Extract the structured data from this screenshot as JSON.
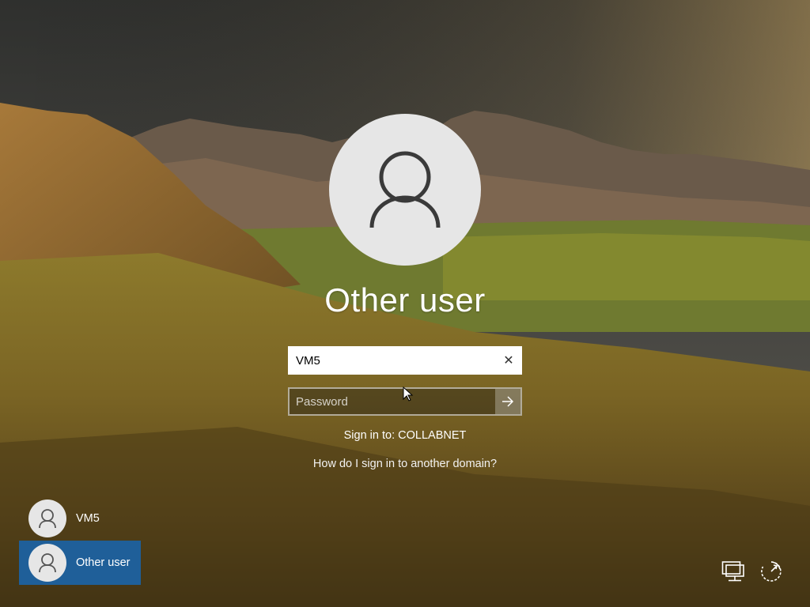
{
  "login": {
    "title": "Other user",
    "username_value": "VM5",
    "password_placeholder": "Password",
    "sign_in_to": "Sign in to: COLLABNET",
    "domain_help_link": "How do I sign in to another domain?"
  },
  "user_list": {
    "items": [
      {
        "label": "VM5",
        "selected": false
      },
      {
        "label": "Other user",
        "selected": true
      }
    ]
  },
  "icons": {
    "avatar": "user-silhouette-icon",
    "clear": "close-icon",
    "submit": "arrow-right-icon",
    "network": "network-icon",
    "power": "power-icon"
  },
  "colors": {
    "selected_user_bg": "#1f5f99",
    "avatar_bg": "#e6e6e6"
  }
}
